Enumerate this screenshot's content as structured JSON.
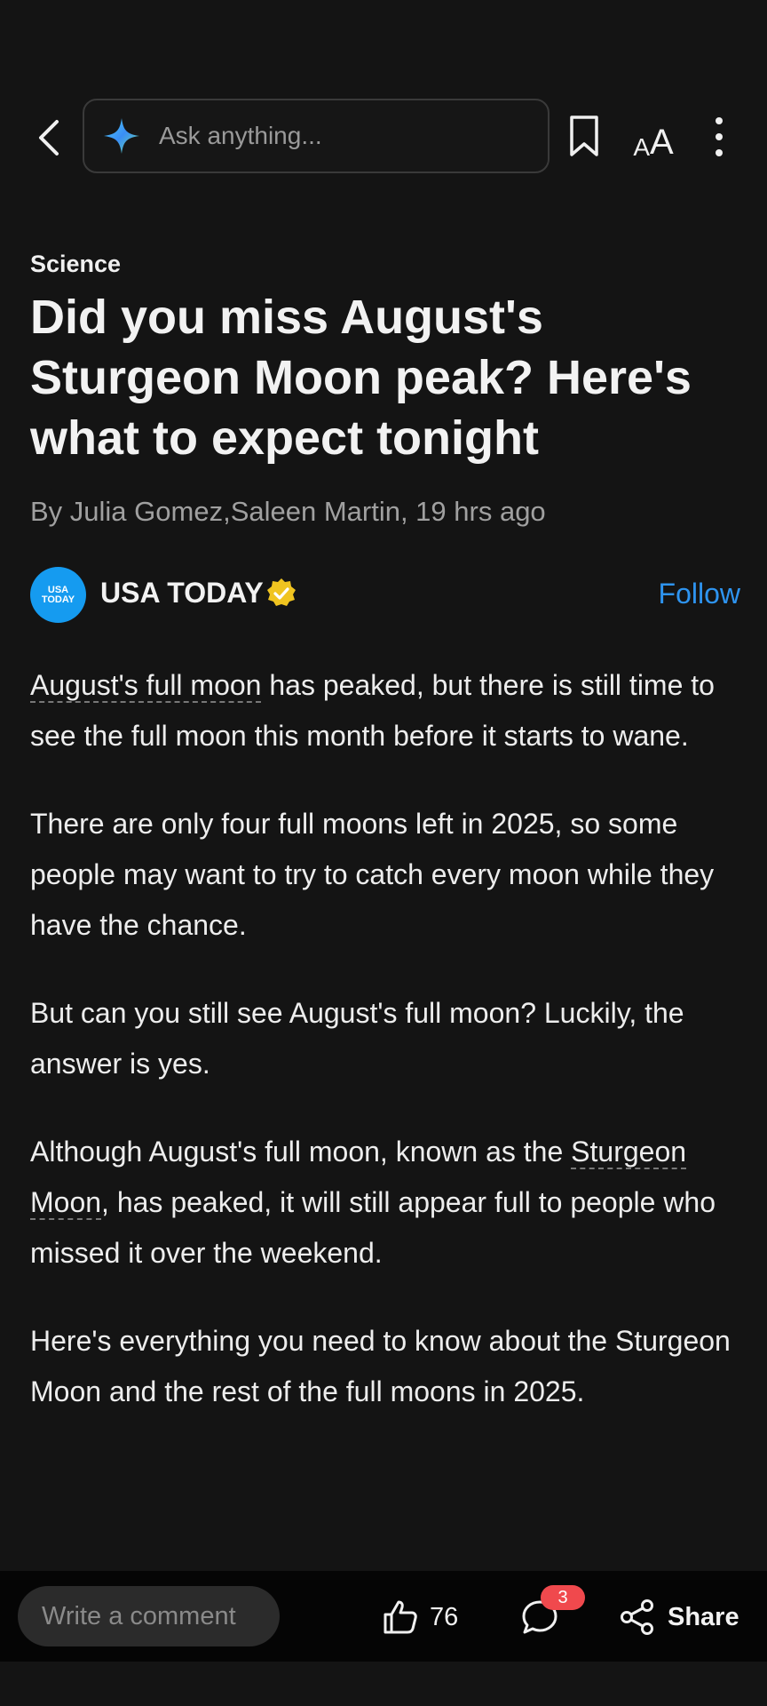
{
  "topbar": {
    "search_placeholder": "Ask anything...",
    "icons": [
      "chevron-left-icon",
      "sparkle-icon",
      "bookmark-icon",
      "text-size-icon",
      "more-vertical-icon"
    ],
    "text_size_small": "A",
    "text_size_big": "A"
  },
  "article": {
    "category": "Science",
    "headline": "Did you miss August's Sturgeon Moon peak? Here's what to expect tonight",
    "byline": "By Julia Gomez,Saleen Martin,  19 hrs ago",
    "source": {
      "logo_line1": "USA",
      "logo_line2": "TODAY",
      "name": "USA TODAY",
      "follow_label": "Follow",
      "verified_color": "#f0c420"
    },
    "paragraphs": {
      "p1_link": "August's full moon",
      "p1_rest": " has peaked, but there is still time to see the full moon this month before it starts to wane.",
      "p2": "There are only four full moons left in 2025, so some people may want to try to catch every moon while they have the chance.",
      "p3": "But can you still see August's full moon? Luckily, the answer is yes.",
      "p4_before": "Although August's full moon, known as the ",
      "p4_link": "Sturgeon Moon",
      "p4_after": ", has peaked, it will still appear full to people who missed it over the weekend.",
      "p5": "Here's everything you need to know about the Sturgeon Moon and the rest of the full moons in 2025."
    }
  },
  "bottombar": {
    "comment_placeholder": "Write a comment",
    "like_count": "76",
    "comment_count": "3",
    "share_label": "Share",
    "badge_color": "#f0494d"
  },
  "colors": {
    "background": "#141414",
    "accent": "#2e94f0"
  }
}
